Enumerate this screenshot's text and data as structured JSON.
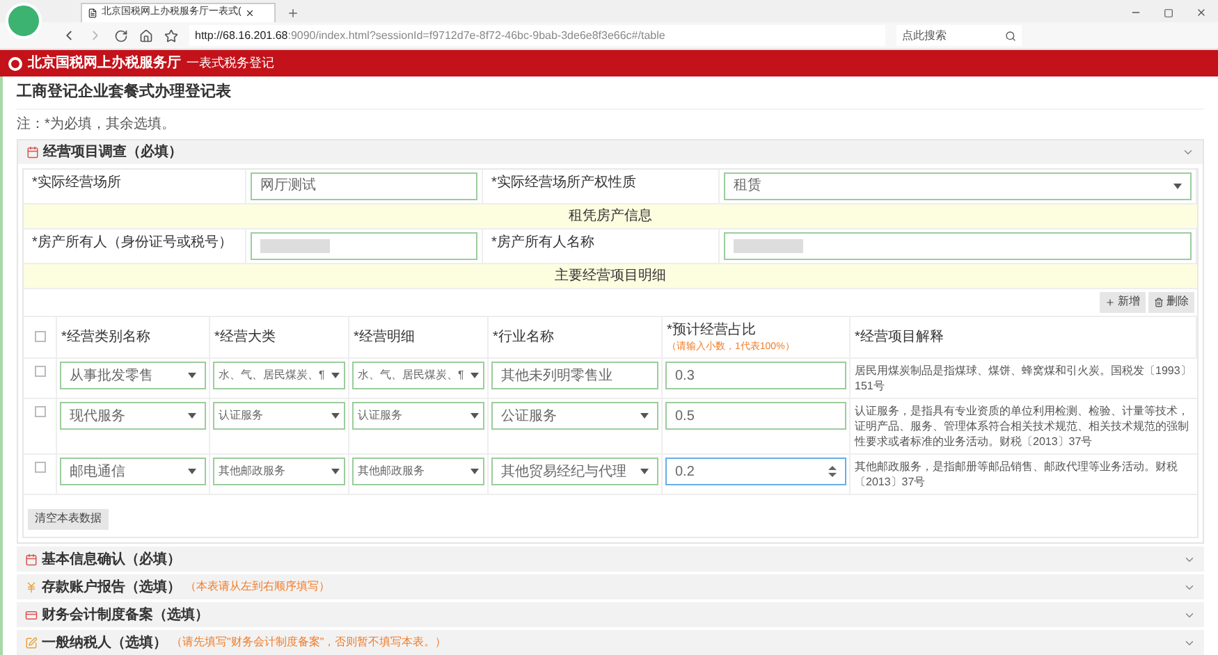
{
  "browser": {
    "tab_title": "北京国税网上办税服务厅一表式(",
    "url_host": "http://68.16.201.68",
    "url_rest": ":9090/index.html?sessionId=f9712d7e-8f72-46bc-9bab-3de6e8f3e66c#/table",
    "search_placeholder": "点此搜索"
  },
  "header": {
    "title": "北京国税网上办税服务厅",
    "subtitle": "一表式税务登记"
  },
  "page_title": "工商登记企业套餐式办理登记表",
  "note": "注：*为必填，其余选填。",
  "panel": {
    "title": "经营项目调查（必填）",
    "expanded": true,
    "fields": [
      {
        "label": "*实际经营场所",
        "kind": "input",
        "value": "网厅测试"
      },
      {
        "label": "*实际经营场所产权性质",
        "kind": "select",
        "value": "租赁"
      }
    ],
    "band_1": "租凭房产信息",
    "owner_fields": [
      {
        "label": "*房产所有人（身份证号或税号）",
        "kind": "redacted"
      },
      {
        "label": "*房产所有人名称",
        "kind": "redacted"
      }
    ],
    "band_2": "主要经营项目明细",
    "buttons": [
      {
        "label": "新增",
        "kind": "add"
      },
      {
        "label": "删除",
        "kind": "delete"
      }
    ],
    "table": {
      "columns": [
        "*经营类别名称",
        "*经营大类",
        "*经营明细",
        "*行业名称",
        "*预计经营占比",
        "*经营项目解释"
      ],
      "ratio_hint": "（请输入小数，1代表100%）",
      "header_checked": false,
      "rows": [
        {
          "checked": false,
          "category": "从事批发零售",
          "major": "水、气、居民煤炭、¶",
          "detail": "水、气、居民煤炭、¶",
          "industry": {
            "kind": "input",
            "value": "其他未列明零售业"
          },
          "ratio": "0.3",
          "focused": false,
          "explanation": "居民用煤炭制品是指煤球、煤饼、蜂窝煤和引火炭。国税发〔1993〕151号"
        },
        {
          "checked": false,
          "category": "现代服务",
          "major": "认证服务",
          "detail": "认证服务",
          "industry": {
            "kind": "select",
            "value": "公证服务"
          },
          "ratio": "0.5",
          "focused": false,
          "explanation": "认证服务，是指具有专业资质的单位利用检测、检验、计量等技术，证明产品、服务、管理体系符合相关技术规范、相关技术规范的强制性要求或者标准的业务活动。财税〔2013〕37号"
        },
        {
          "checked": false,
          "category": "邮电通信",
          "major": "其他邮政服务",
          "detail": "其他邮政服务",
          "industry": {
            "kind": "select",
            "value": "其他贸易经纪与代理"
          },
          "ratio": "0.2",
          "focused": true,
          "explanation": "其他邮政服务，是指邮册等邮品销售、邮政代理等业务活动。财税〔2013〕37号"
        }
      ]
    },
    "clear_button": "清空本表数据"
  },
  "sections": [
    {
      "title": "基本信息确认（必填）",
      "expanded": false
    },
    {
      "title": "存款账户报告（选填）",
      "note": "（本表请从左到右顺序填写）",
      "expanded": false
    },
    {
      "title": "财务会计制度备案（选填）",
      "expanded": false
    },
    {
      "title": "一般纳税人（选填）",
      "note": "（请先填写\"财务会计制度备案\"，否则暂不填写本表。）",
      "expanded": false
    }
  ]
}
